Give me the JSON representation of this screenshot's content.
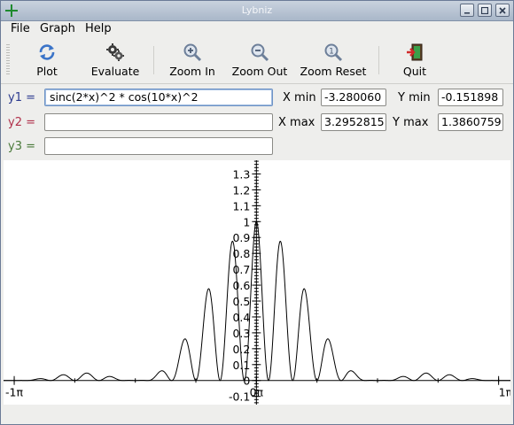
{
  "window": {
    "title": "Lybniz"
  },
  "menu": {
    "file": "File",
    "graph": "Graph",
    "help": "Help"
  },
  "toolbar": {
    "plot": "Plot",
    "evaluate": "Evaluate",
    "zoom_in": "Zoom In",
    "zoom_out": "Zoom Out",
    "zoom_reset": "Zoom Reset",
    "quit": "Quit"
  },
  "functions": [
    {
      "label": "y1 =",
      "value": "sinc(2*x)^2 * cos(10*x)^2",
      "color": "#2b3a8f"
    },
    {
      "label": "y2 =",
      "value": "",
      "color": "#b0304a"
    },
    {
      "label": "y3 =",
      "value": "",
      "color": "#4a7a3a"
    }
  ],
  "range": {
    "x_min_label": "X min",
    "x_min": "-3.280060",
    "x_max_label": "X max",
    "x_max": "3.2952815",
    "y_min_label": "Y min",
    "y_min": "-0.151898",
    "y_max_label": "Y max",
    "y_max": "1.3860759"
  },
  "colors": {
    "axis": "#000000",
    "curve": "#000000",
    "titlebar": "#aab8cb"
  },
  "chart_data": {
    "type": "line",
    "function": "sinc(2*x)^2 * cos(10*x)^2",
    "xlim": [
      -3.28006,
      3.2952815
    ],
    "ylim": [
      -0.151898,
      1.3860759
    ],
    "x_tick_labels": [
      "-1π",
      "0π",
      "1π"
    ],
    "x_ticks": [
      -3.14159,
      0,
      3.14159
    ],
    "y_tick_labels": [
      "-0.1",
      "0",
      "0.1",
      "0.2",
      "0.3",
      "0.4",
      "0.5",
      "0.6",
      "0.7",
      "0.8",
      "0.9",
      "1",
      "1.1",
      "1.2",
      "1.3"
    ],
    "y_ticks": [
      -0.1,
      0,
      0.1,
      0.2,
      0.3,
      0.4,
      0.5,
      0.6,
      0.7,
      0.8,
      0.9,
      1,
      1.1,
      1.2,
      1.3
    ]
  }
}
